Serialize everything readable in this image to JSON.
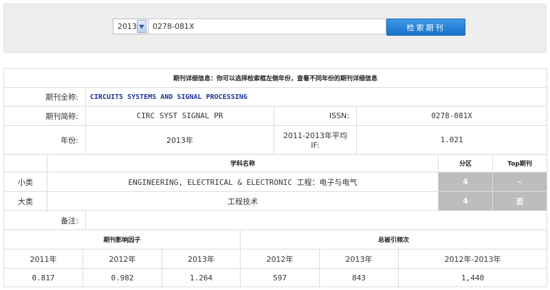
{
  "search": {
    "year": "2013",
    "query": "0278-081X",
    "button_label": "检索期刊"
  },
  "detail": {
    "header_note": "期刊详细信息：你可以选择检索框左侧年份，查看不同年份的期刊详细信息",
    "full_name_label": "期刊全称:",
    "full_name": "CIRCUITS SYSTEMS AND SIGNAL PROCESSING",
    "abbr_label": "期刊简称:",
    "abbr": "CIRC SYST SIGNAL PR",
    "issn_label": "ISSN:",
    "issn": "0278-081X",
    "year_label": "年份:",
    "year": "2013年",
    "avg_if_label": "2011-2013年平均IF:",
    "avg_if": "1.021",
    "subject_header": "学科名称",
    "zone_header": "分区",
    "top_header": "Top期刊",
    "small_cat_label": "小类",
    "small_cat_name": "ENGINEERING, ELECTRICAL & ELECTRONIC 工程：电子与电气",
    "small_cat_zone": "4",
    "small_cat_top": "-",
    "big_cat_label": "大类",
    "big_cat_name": "工程技术",
    "big_cat_zone": "4",
    "big_cat_top": "否",
    "remark_label": "备注:",
    "remark": ""
  },
  "impact": {
    "if_header": "期刊影响因子",
    "cites_header": "总被引频次",
    "if_years": [
      "2011年",
      "2012年",
      "2013年"
    ],
    "if_values": [
      "0.817",
      "0.982",
      "1.264"
    ],
    "cites_years": [
      "2012年",
      "2013年",
      "2012年-2013年"
    ],
    "cites_values": [
      "597",
      "843",
      "1,440"
    ]
  },
  "colors": {
    "button_blue": "#1e78d0",
    "zone_gray": "#bdbdbd",
    "fullname_blue": "#1a3399"
  }
}
